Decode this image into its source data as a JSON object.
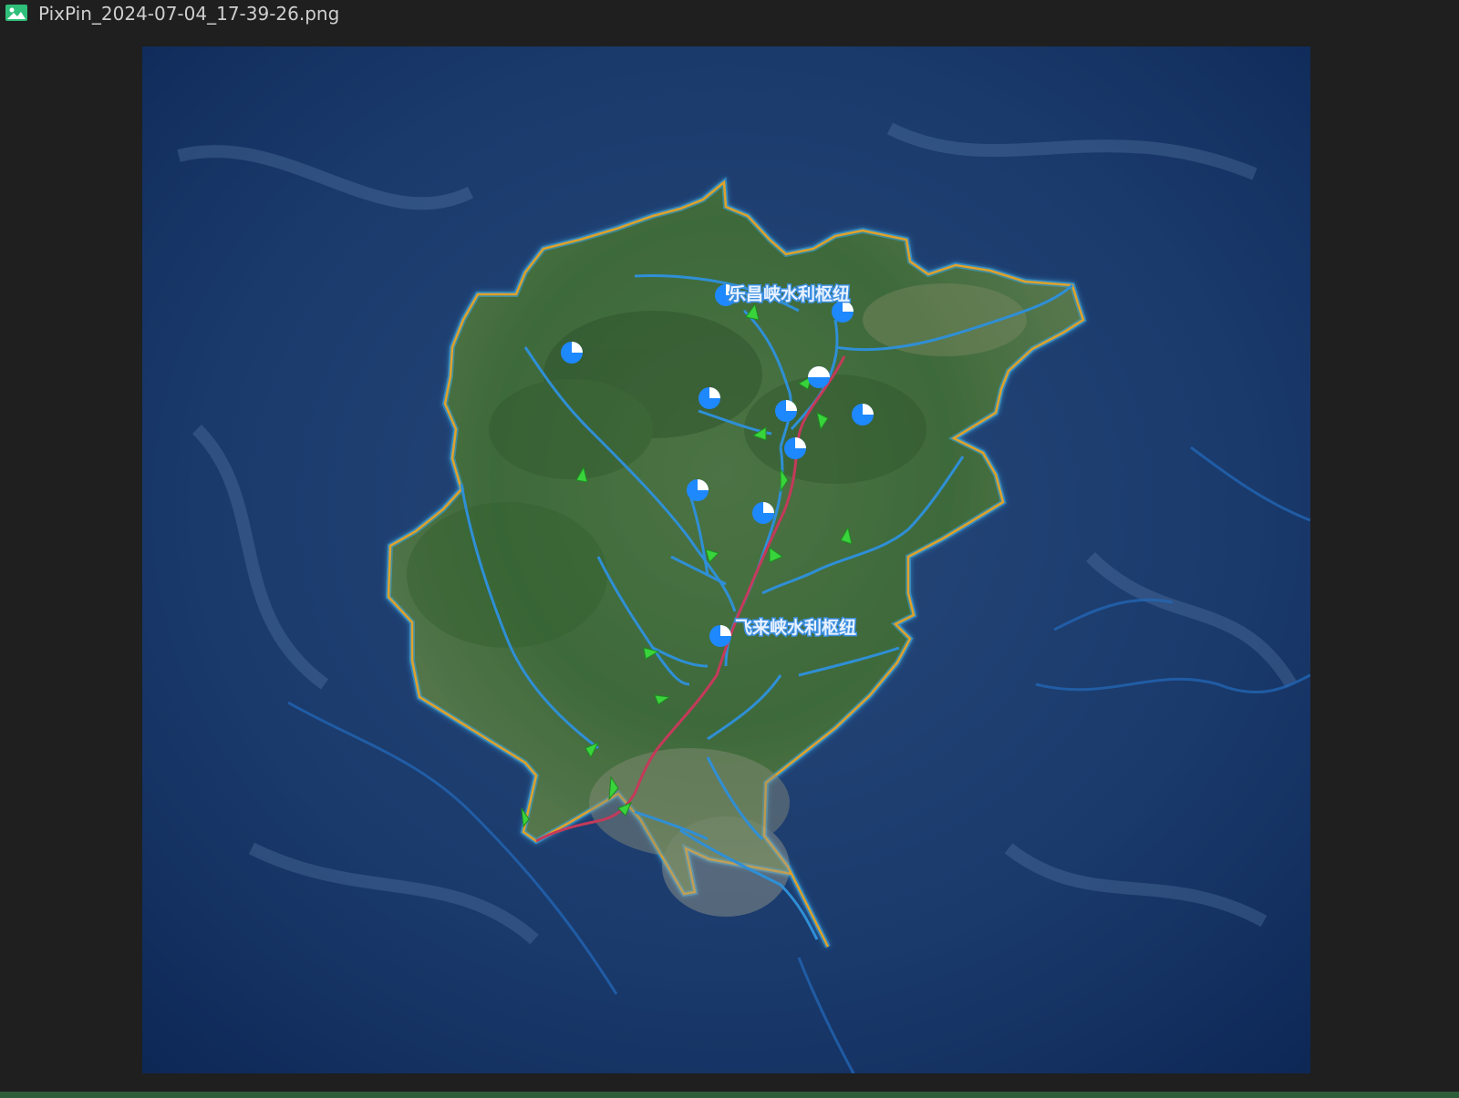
{
  "window": {
    "title": "PixPin_2024-07-04_17-39-26.png",
    "icon": "image-file-icon"
  },
  "map": {
    "labels": {
      "north_hub": "乐昌峡水利枢纽",
      "south_hub": "飞来峡水利枢纽"
    },
    "colors": {
      "background": "#16366b",
      "land": "#3f6b3c",
      "boundary": "#e0a22a",
      "boundary_glow": "#3aa7e6",
      "river": "#2f8fd6",
      "main_channel": "#c43a5a",
      "station": "#1e88ff",
      "marker": "#39d43b",
      "label_text": "#e8f2ff",
      "label_halo": "#3b8fe0"
    },
    "stations": [
      "station-1",
      "station-2",
      "station-3",
      "station-4",
      "station-5",
      "station-6",
      "station-7",
      "station-8",
      "station-9",
      "station-10",
      "station-11",
      "station-12"
    ]
  }
}
